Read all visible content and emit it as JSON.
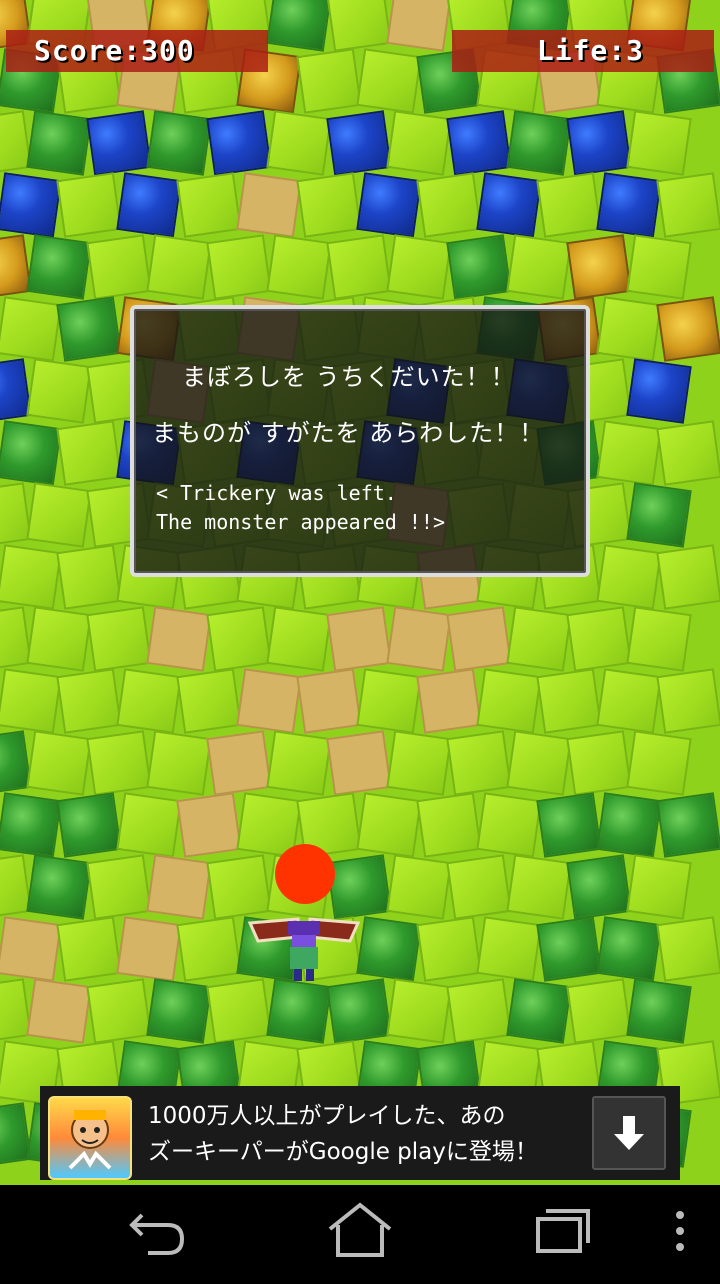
{
  "hud": {
    "score_label": "Score:300",
    "life_label": "Life:3"
  },
  "dialog": {
    "line1_jp": "まぼろしを うちくだいた！！",
    "line2_jp": "まものが すがたを あらわした！！",
    "line3_en": "< Trickery was left.",
    "line4_en": "The monster appeared !!>"
  },
  "ad": {
    "line1": "1000万人以上がプレイした、あの",
    "line2": "ズーキーパーがGoogle playに登場！",
    "icon": "zookeeper-app-icon",
    "button_icon": "download-arrow-icon"
  },
  "navbar": {
    "back_icon": "back-icon",
    "home_icon": "home-icon",
    "recents_icon": "recent-apps-icon",
    "menu_icon": "overflow-menu-icon"
  },
  "colors": {
    "grass": "#9fdc1f",
    "sand": "#d6b466",
    "water": "#1d44c8",
    "hud_bar": "#aa1e14",
    "target_dot": "#ff3300"
  }
}
